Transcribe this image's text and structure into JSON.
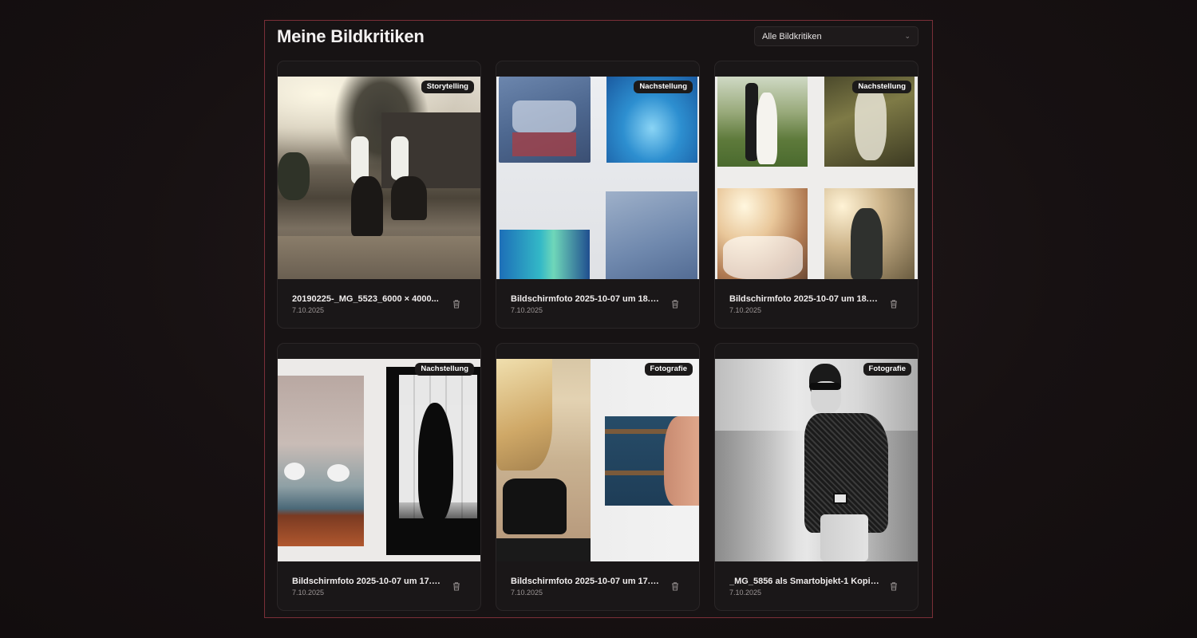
{
  "header": {
    "title": "Meine Bildkritiken"
  },
  "filter": {
    "selected": "Alle Bildkritiken",
    "icon": "chevron-down-icon"
  },
  "cards": [
    {
      "badge": "Storytelling",
      "filename": "20190225-_MG_5523_6000 × 4000...",
      "date": "7.10.2025"
    },
    {
      "badge": "Nachstellung",
      "filename": "Bildschirmfoto 2025-10-07 um 18.0...",
      "date": "7.10.2025"
    },
    {
      "badge": "Nachstellung",
      "filename": "Bildschirmfoto 2025-10-07 um 18.0...",
      "date": "7.10.2025"
    },
    {
      "badge": "Nachstellung",
      "filename": "Bildschirmfoto 2025-10-07 um 17.5...",
      "date": "7.10.2025"
    },
    {
      "badge": "Fotografie",
      "filename": "Bildschirmfoto 2025-10-07 um 17.4...",
      "date": "7.10.2025"
    },
    {
      "badge": "Fotografie",
      "filename": "_MG_5856 als Smartobjekt-1 Kopie....",
      "date": "7.10.2025"
    }
  ],
  "colors": {
    "accent_border": "#7a2f38",
    "card_bg": "#1a1718",
    "page_bg": "#171112"
  }
}
